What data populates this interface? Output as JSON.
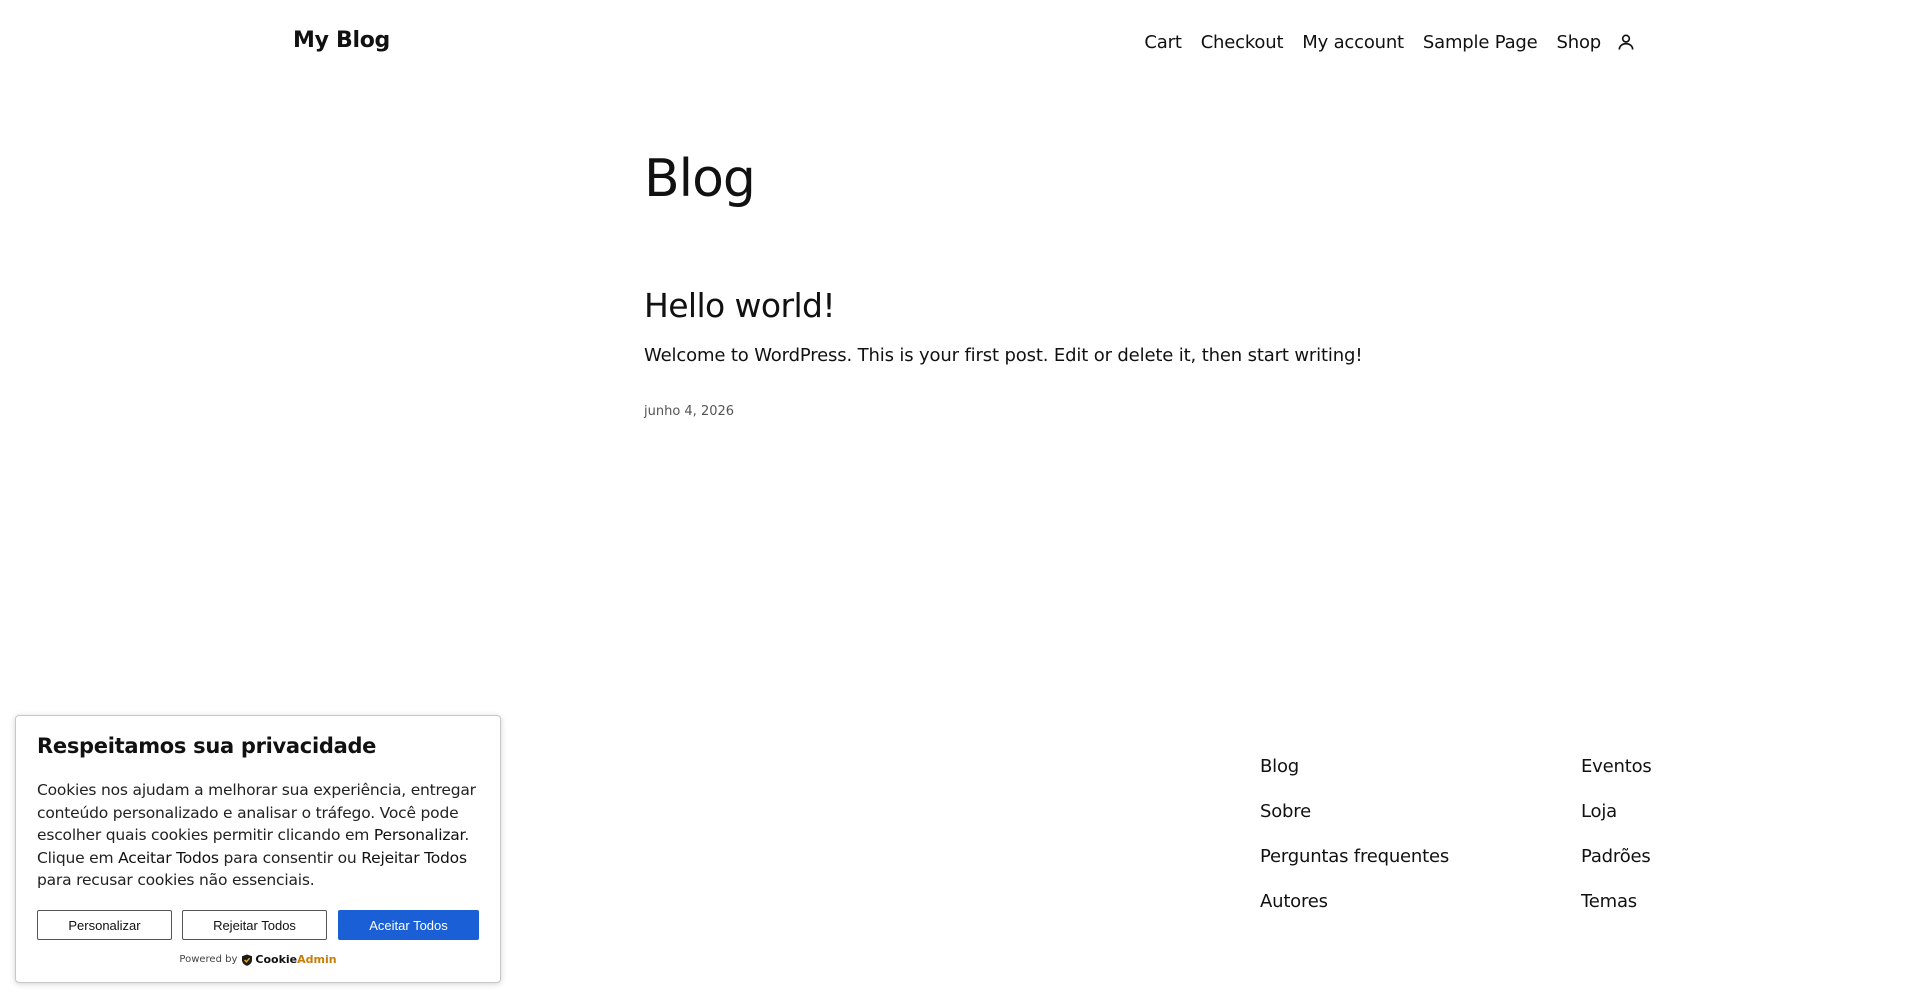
{
  "header": {
    "site_title": "My Blog",
    "nav": [
      "Cart",
      "Checkout",
      "My account",
      "Sample Page",
      "Shop"
    ],
    "account_icon": "user-icon"
  },
  "main": {
    "page_title": "Blog",
    "post": {
      "title": "Hello world!",
      "excerpt": "Welcome to WordPress. This is your first post. Edit or delete it, then start writing!",
      "date": "junho 4, 2026"
    }
  },
  "footer": {
    "col1": [
      "Blog",
      "Sobre",
      "Perguntas frequentes",
      "Autores"
    ],
    "col2": [
      "Eventos",
      "Loja",
      "Padrões",
      "Temas"
    ]
  },
  "cookie": {
    "title": "Respeitamos sua privacidade",
    "text_1": "Cookies nos ajudam a melhorar sua experiência, entregar conteúdo personalizado e analisar o tráfego. Você pode escolher quais cookies permitir clicando em ",
    "text_customize": "Personalizar",
    "text_2": ". Clique em ",
    "text_accept": "Aceitar Todos",
    "text_3": " para consentir ou ",
    "text_reject": "Rejeitar Todos",
    "text_4": " para recusar cookies não essenciais.",
    "btn_customize": "Personalizar",
    "btn_reject": "Rejeitar Todos",
    "btn_accept": "Aceitar Todos",
    "powered_by": "Powered by",
    "brand_1": "Cookie",
    "brand_2": "Admin",
    "accent_color": "#1a5fd6"
  }
}
